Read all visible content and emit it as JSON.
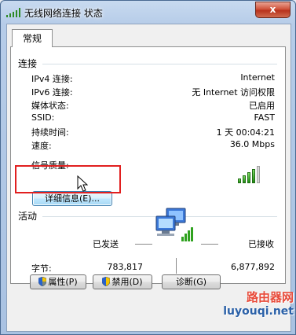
{
  "window": {
    "title": "无线网络连接 状态",
    "close": "x"
  },
  "tabs": [
    {
      "label": "常规"
    }
  ],
  "connection": {
    "heading": "连接",
    "rows": [
      {
        "label": "IPv4 连接:",
        "value": "Internet"
      },
      {
        "label": "IPv6 连接:",
        "value": "无 Internet 访问权限"
      },
      {
        "label": "媒体状态:",
        "value": "已启用"
      },
      {
        "label": "SSID:",
        "value": "FAST"
      },
      {
        "label": "持续时间:",
        "value": "1 天 00:04:21"
      },
      {
        "label": "速度:",
        "value": "36.0 Mbps"
      }
    ],
    "signal_label": "信号质量:",
    "signal_bars_filled": 4,
    "signal_bars_total": 5,
    "details_button": "详细信息(E)..."
  },
  "activity": {
    "heading": "活动",
    "sent_label": "已发送",
    "received_label": "已接收",
    "bytes_label": "字节:",
    "bytes_sent": "783,817",
    "bytes_received": "6,877,892"
  },
  "buttons": {
    "properties": "属性(P)",
    "disable": "禁用(D)",
    "diagnose": "诊断(G)"
  },
  "watermark": {
    "line1": "路由器网",
    "line2": "luyouqi.net"
  },
  "colors": {
    "accent": "#3c7fb1",
    "highlight_border": "#e11f1f",
    "signal_green": "#2e8a24"
  }
}
